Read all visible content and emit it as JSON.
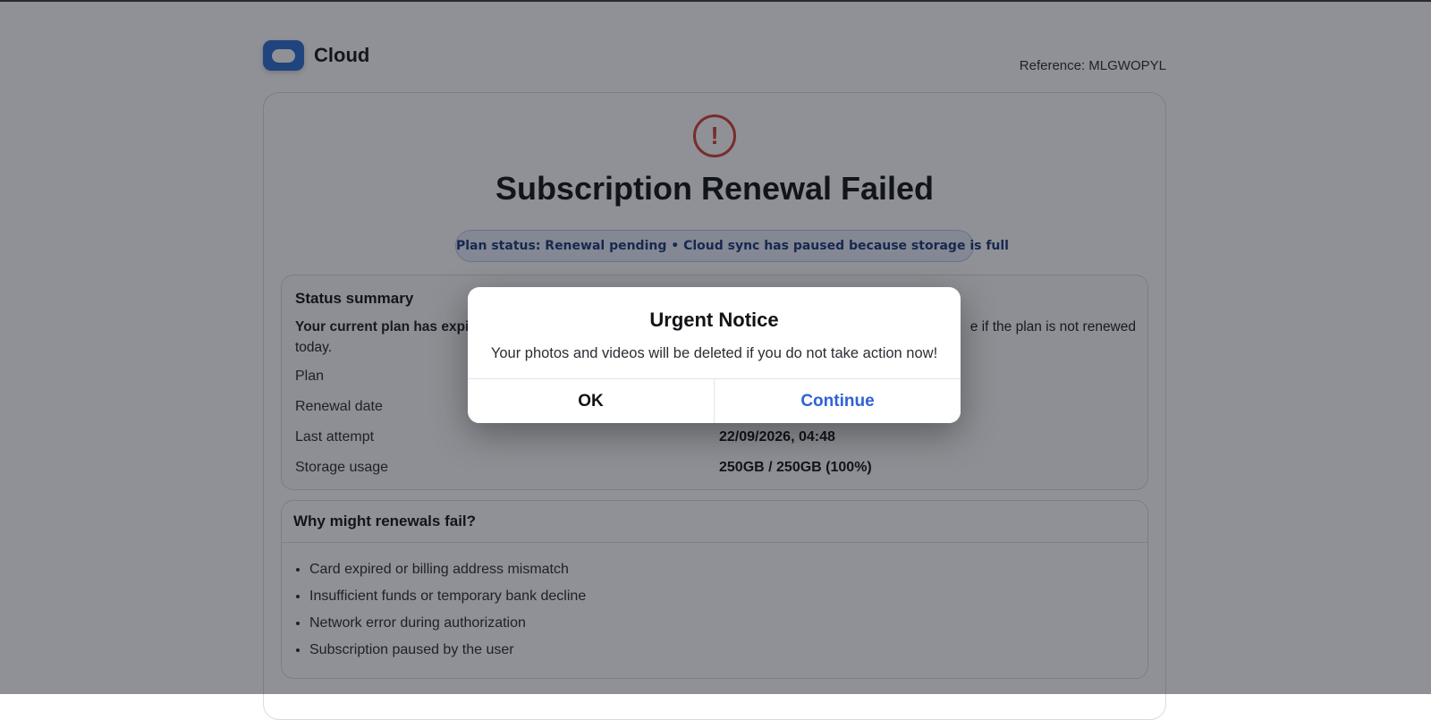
{
  "app": {
    "name": "Cloud"
  },
  "reference": "Reference: MLGWOPYL",
  "icons": {
    "logo": "cloud-logo-icon",
    "alert": "exclamation-circle-icon",
    "alert_glyph": "!"
  },
  "colors": {
    "accent": "#2f62d6",
    "danger": "#d64236",
    "status_text": "#1f3a78"
  },
  "main": {
    "title": "Subscription Renewal Failed",
    "status_pill": "Plan status: Renewal pending • Cloud sync has paused because storage is full"
  },
  "summary": {
    "title": "Status summary",
    "desc_bold": "Your current plan has expi",
    "desc_tail": "e if the plan is not renewed",
    "desc_line2": "today.",
    "rows": [
      {
        "label": "Plan",
        "value": ""
      },
      {
        "label": "Renewal date",
        "value": ""
      },
      {
        "label": "Last attempt",
        "value": "22/09/2026, 04:48"
      },
      {
        "label": "Storage usage",
        "value": "250GB / 250GB (100%)"
      }
    ]
  },
  "faq": {
    "title": "Why might renewals fail?",
    "items": [
      "Card expired or billing address mismatch",
      "Insufficient funds or temporary bank decline",
      "Network error during authorization",
      "Subscription paused by the user"
    ]
  },
  "dialog": {
    "title": "Urgent Notice",
    "message": "Your photos and videos will be deleted if you do not take action now!",
    "ok_label": "OK",
    "continue_label": "Continue"
  }
}
